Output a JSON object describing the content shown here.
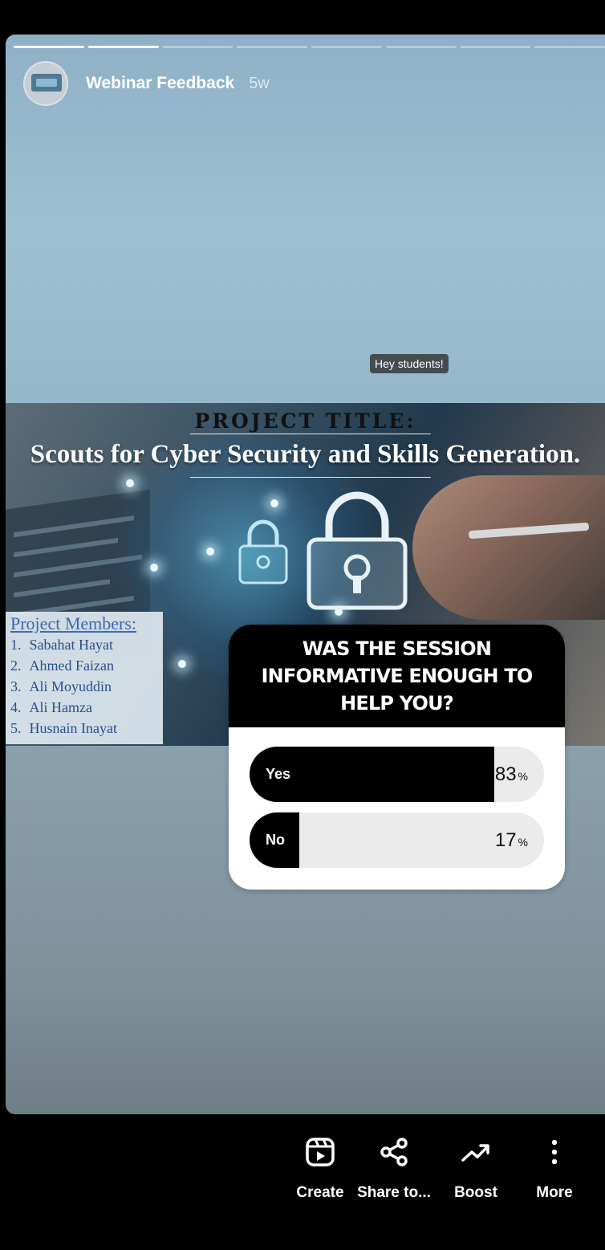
{
  "story": {
    "username": "Webinar Feedback",
    "time": "5w",
    "progress_segments": 8,
    "progress_completed": 2,
    "caption_sticker": "Hey students!"
  },
  "slide": {
    "label": "PROJECT TITLE:",
    "title": "Scouts for Cyber Security and Skills Generation.",
    "members_heading": "Project Members:",
    "members": [
      {
        "num": "1.",
        "name": "Sabahat Hayat"
      },
      {
        "num": "2.",
        "name": "Ahmed Faizan"
      },
      {
        "num": "3.",
        "name": "Ali Moyuddin"
      },
      {
        "num": "4.",
        "name": "Ali Hamza"
      },
      {
        "num": "5.",
        "name": "Husnain Inayat"
      }
    ]
  },
  "poll": {
    "question": "WAS THE SESSION INFORMATIVE ENOUGH TO HELP YOU?",
    "options": [
      {
        "label": "Yes",
        "percent": 83,
        "percent_text": "83",
        "unit": "%"
      },
      {
        "label": "No",
        "percent": 17,
        "percent_text": "17",
        "unit": "%"
      }
    ]
  },
  "actions": [
    {
      "label": "Create",
      "icon": "reels-icon"
    },
    {
      "label": "Share to...",
      "icon": "share-icon"
    },
    {
      "label": "Boost",
      "icon": "trending-up-icon"
    },
    {
      "label": "More",
      "icon": "more-vertical-icon"
    }
  ],
  "colors": {
    "background": "#000000",
    "poll_fill": "#000000",
    "poll_track": "#ebebeb",
    "members_text": "#2a4f8a"
  }
}
